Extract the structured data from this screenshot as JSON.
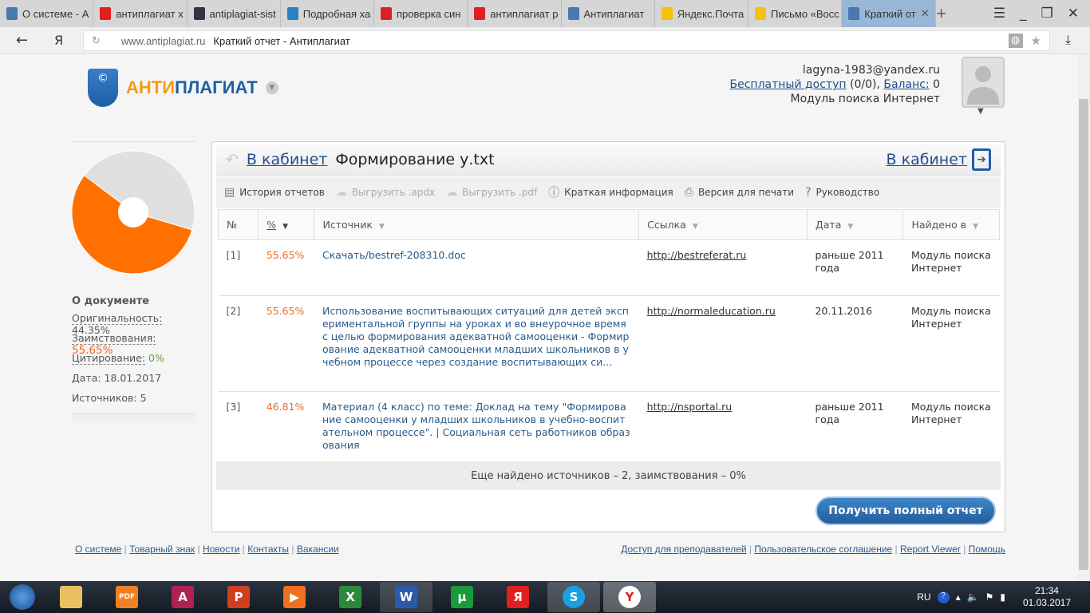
{
  "browser": {
    "tabs": [
      {
        "label": "О системе - А",
        "icon": "shield-icon",
        "color": "#4a78b0"
      },
      {
        "label": "антиплагиат х",
        "icon": "yandex-icon",
        "color": "#e02020"
      },
      {
        "label": "antiplagiat-sist",
        "icon": "msu-icon",
        "color": "#334"
      },
      {
        "label": "Подробная ха",
        "icon": "window-icon",
        "color": "#2a80c0"
      },
      {
        "label": "проверка син",
        "icon": "yandex-icon",
        "color": "#e02020"
      },
      {
        "label": "антиплагиат р",
        "icon": "yandex-icon",
        "color": "#e02020"
      },
      {
        "label": "Антиплагиат",
        "icon": "shield-icon",
        "color": "#4a78b0"
      },
      {
        "label": "Яндекс.Почта",
        "icon": "mail-icon",
        "color": "#f5c400"
      },
      {
        "label": "Письмо «Восс",
        "icon": "mail-icon",
        "color": "#f5c400"
      },
      {
        "label": "Краткий от",
        "icon": "shield-icon",
        "color": "#4a78b0"
      }
    ],
    "url_domain": "www.antiplagiat.ru",
    "url_title": "Краткий отчет - Антиплагиат",
    "yandex_button": "Я"
  },
  "header": {
    "brand_a": "АНТИ",
    "brand_b": "ПЛАГИАТ",
    "brand_color_a": "#f39c12",
    "brand_color_b": "#1f5ea8",
    "email": "lagyna-1983@yandex.ru",
    "free_access": "Бесплатный доступ",
    "free_count": " (0/0), ",
    "balance_label": "Баланс:",
    "balance_value": " 0",
    "module": "Модуль поиска Интернет"
  },
  "sidebar": {
    "chart_data": {
      "type": "pie",
      "values": [
        {
          "label": "Оригинальность",
          "value": 44.35,
          "color": "#e0e0e0"
        },
        {
          "label": "Заимствования",
          "value": 55.65,
          "color": "#ff7000"
        }
      ]
    },
    "title": "О документе",
    "originality_label": "Оригинальность:",
    "originality_value": "44.35%",
    "borrow_label": "Заимствования:",
    "borrow_value": "55.65%",
    "cite_label": "Цитирование:",
    "cite_value": "0%",
    "date": "Дата: 18.01.2017",
    "sources": "Источников: 5"
  },
  "report": {
    "back_link": "В кабинет",
    "filename": "Формирование у.txt",
    "cabinet_link": "В кабинет",
    "toolbar": [
      "История отчетов",
      "Выгрузить .apdx",
      "Выгрузить .pdf",
      "Краткая информация",
      "Версия для печати",
      "Руководство"
    ],
    "columns": [
      "№",
      "%",
      "Источник",
      "Ссылка",
      "Дата",
      "Найдено в"
    ],
    "rows": [
      {
        "n": "[1]",
        "pct": "55.65%",
        "source": "Скачать/bestref-208310.doc",
        "link": "http://bestreferat.ru",
        "date": "раньше 2011 года",
        "found": "Модуль поиска Интернет"
      },
      {
        "n": "[2]",
        "pct": "55.65%",
        "source": "Использование воспитывающих ситуаций для детей экспериментальной группы на уроках и во внеурочное время с целью формирования адекватной самооценки - Формирование адекватной самооценки младших школьников в учебном процессе через создание воспитывающих си...",
        "link": "http://normaleducation.ru",
        "date": "20.11.2016",
        "found": "Модуль поиска Интернет"
      },
      {
        "n": "[3]",
        "pct": "46.81%",
        "source": "Материал (4 класс) по теме: Доклад на тему \"Формирование самооценки у младших школьников в учебно-воспитательном процессе\". | Социальная сеть работников образования",
        "link": "http://nsportal.ru",
        "date": "раньше 2011 года",
        "found": "Модуль поиска Интернет"
      }
    ],
    "more": "Еще найдено источников – 2, заимствования – 0%",
    "full_report_button": "Получить полный отчет"
  },
  "footer": {
    "left": [
      "О системе",
      "Товарный знак",
      "Новости",
      "Контакты",
      "Вакансии"
    ],
    "right": [
      "Доступ для преподавателей",
      "Пользовательское соглашение",
      "Report Viewer",
      "Помощь"
    ]
  },
  "taskbar": {
    "lang": "RU",
    "time": "21:34",
    "date": "01.03.2017"
  }
}
